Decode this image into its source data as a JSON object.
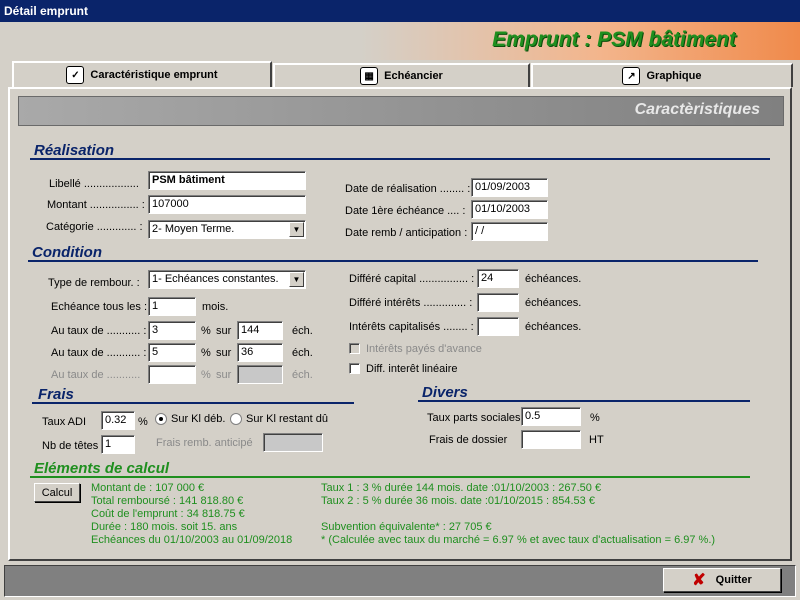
{
  "window": {
    "title": "Détail emprunt"
  },
  "banner": {
    "title": "Emprunt  :  PSM bâtiment"
  },
  "tabs": [
    {
      "label": "Caractéristique emprunt",
      "icon": "checkmark-icon"
    },
    {
      "label": "Echéancier",
      "icon": "calculator-icon"
    },
    {
      "label": "Graphique",
      "icon": "chart-icon"
    }
  ],
  "section_bar": {
    "title": "Caractèristiques"
  },
  "realisation": {
    "heading": "Réalisation",
    "libelle_label": "Libellé  ..................",
    "libelle_value": "PSM bâtiment",
    "montant_label": "Montant ................ :",
    "montant_value": "107000",
    "categorie_label": "Catégorie ............. :",
    "categorie_value": "2- Moyen Terme.",
    "date_real_label": "Date de réalisation ........ :",
    "date_real_value": "01/09/2003",
    "date_ech_label": "Date 1ère échéance .... :",
    "date_ech_value": "01/10/2003",
    "date_remb_label": "Date remb / anticipation :",
    "date_remb_value": " /  /"
  },
  "condition": {
    "heading": "Condition",
    "type_label": "Type de rembour. :",
    "type_value": "1- Echéances constantes.",
    "echeance_label": "Echéance tous les :",
    "echeance_value": "1",
    "echeance_unit": "mois.",
    "taux_label": "Au taux de ........... :",
    "pct": "%",
    "sur": "sur",
    "ech": "éch.",
    "taux1": "3",
    "duree1": "144",
    "taux2": "5",
    "duree2": "36",
    "taux3_label": "Au taux de ...........",
    "differe_capital_label": "Différé capital ................ :",
    "differe_capital_value": "24",
    "differe_interets_label": "Différé intérêts .............. :",
    "interets_capitalises_label": "Intérêts capitalisés ........ :",
    "echeances_unit": "échéances.",
    "interets_payes_label": "Intérêts payés d'avance",
    "diff_interet_label": "Diff. interêt linéaire"
  },
  "frais": {
    "heading": "Frais",
    "taux_adi_label": "Taux ADI",
    "taux_adi_value": "0.32",
    "pct": "%",
    "sur_kl_deb": "Sur Kl déb.",
    "sur_kl_restant": "Sur Kl restant dû",
    "nb_tetes_label": "Nb de têtes",
    "nb_tetes_value": "1",
    "frais_remb_label": "Frais remb. anticipé"
  },
  "divers": {
    "heading": "Divers",
    "taux_parts_label": "Taux parts sociales",
    "taux_parts_value": "0.5",
    "pct": "%",
    "frais_dossier_label": "Frais de dossier",
    "ht": "HT"
  },
  "elements": {
    "heading": "Eléments de calcul",
    "calcul_button": "Calcul",
    "left_lines": [
      "Montant de : 107 000 €",
      "Total remboursé : 141 818.80 €",
      "Coût de l'emprunt : 34 818.75 €",
      "Durée : 180 mois. soit 15. ans",
      "Echéances du 01/10/2003 au 01/09/2018"
    ],
    "right_line1": "Taux 1 : 3 % durée 144 mois. date :01/10/2003 : 267.50 €",
    "right_line2": "Taux 2 : 5 % durée 36 mois. date :01/10/2015 :  854.53 €",
    "subvention": "Subvention équivalente* : 27 705 €",
    "note": "* (Calculée avec taux du marché =  6.97 % et avec taux d'actualisation =  6.97 %.)"
  },
  "footer": {
    "quit_label": "Quitter"
  },
  "colors": {
    "green": "#1f8f1f",
    "blue": "#0a246a",
    "title_bar": "#0a246a"
  }
}
